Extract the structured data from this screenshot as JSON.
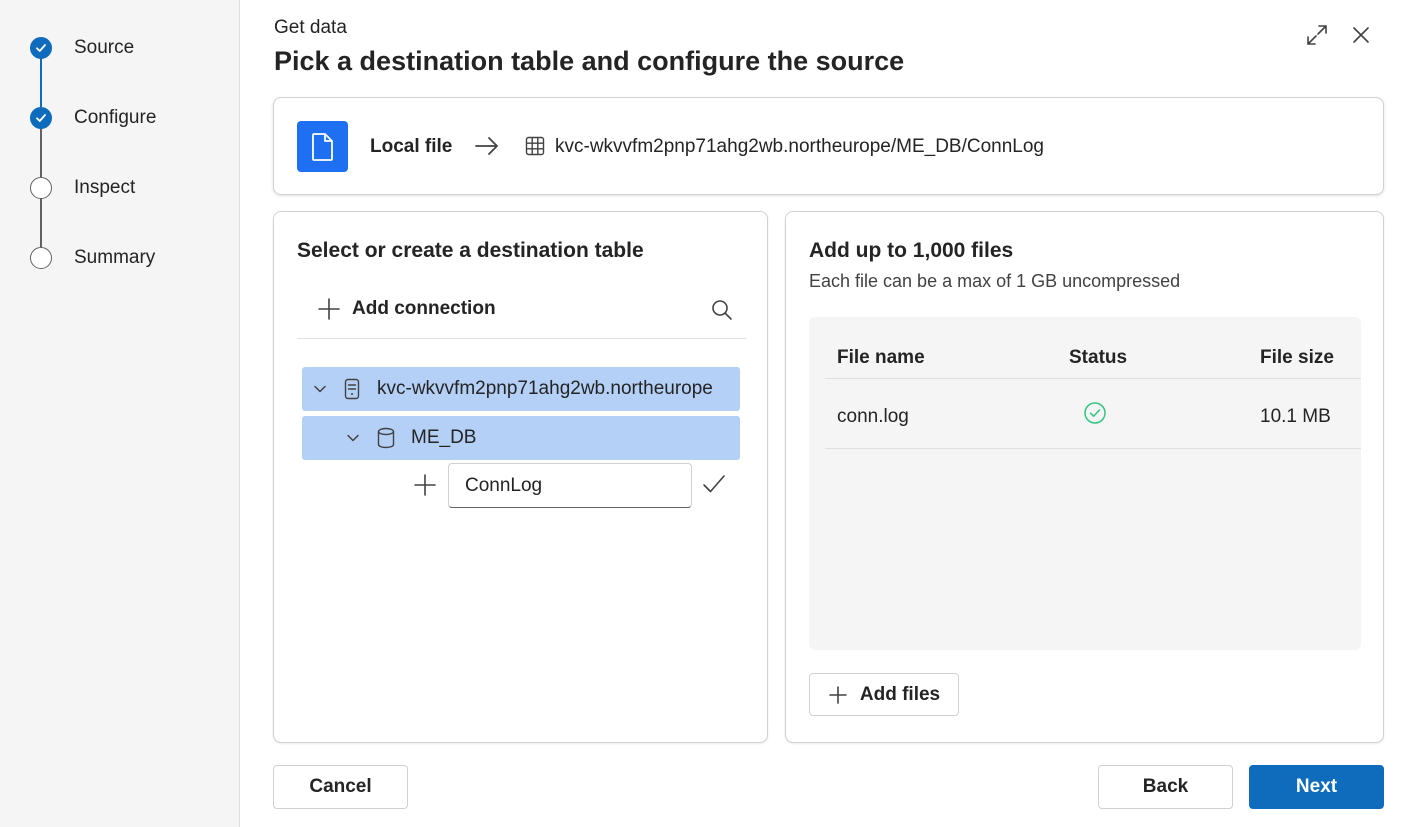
{
  "stepper": {
    "steps": [
      {
        "label": "Source",
        "state": "complete"
      },
      {
        "label": "Configure",
        "state": "complete"
      },
      {
        "label": "Inspect",
        "state": "pending"
      },
      {
        "label": "Summary",
        "state": "pending"
      }
    ]
  },
  "header": {
    "eyebrow": "Get data",
    "title": "Pick a destination table and configure the source",
    "expand_icon": "expand-icon",
    "close_icon": "close-icon"
  },
  "source_bar": {
    "source_icon": "document-icon",
    "source_label": "Local file",
    "arrow_icon": "arrow-right-icon",
    "dest_icon": "table-icon",
    "destination_path": "kvc-wkvvfm2pnp71ahg2wb.northeurope/ME_DB/ConnLog"
  },
  "destination": {
    "title": "Select or create a destination table",
    "add_connection_label": "Add connection",
    "tree": {
      "cluster": "kvc-wkvvfm2pnp71ahg2wb.northeurope",
      "database": "ME_DB",
      "new_table_value": "ConnLog"
    }
  },
  "files": {
    "title": "Add up to 1,000 files",
    "subtitle": "Each file can be a max of 1 GB uncompressed",
    "columns": [
      "File name",
      "Status",
      "File size"
    ],
    "rows": [
      {
        "name": "conn.log",
        "status": "success",
        "size": "10.1 MB"
      }
    ],
    "add_files_label": "Add files"
  },
  "footer": {
    "cancel_label": "Cancel",
    "back_label": "Back",
    "next_label": "Next"
  },
  "colors": {
    "accent": "#0f6cbd",
    "selected_row": "#b4d0f7",
    "success": "#33c481",
    "file_tile": "#1e6ff2"
  }
}
